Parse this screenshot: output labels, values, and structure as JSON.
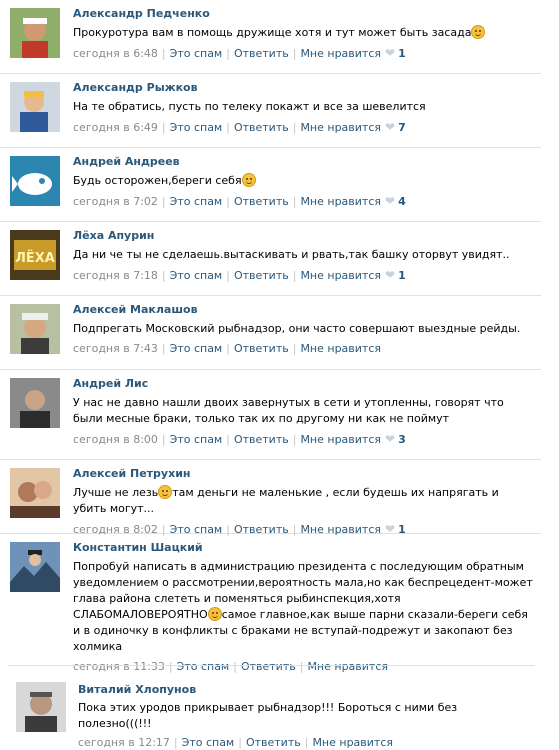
{
  "comments": [
    {
      "author": "Александр Педченко",
      "text": "Прокуротура вам в помощь дружище хотя и тут может быть засада",
      "emoji": true,
      "time": "сегодня в 6:48",
      "spam": "Это спам",
      "reply": "Ответить",
      "like": "Мне нравится",
      "likes": "1",
      "avatar_color": "#b06a3c"
    },
    {
      "author": "Александр Рыжков",
      "text": "На те обратись, пусть по телеку покажт и все за шевелится",
      "emoji": false,
      "time": "сегодня в 6:49",
      "spam": "Это спам",
      "reply": "Ответить",
      "like": "Мне нравится",
      "likes": "7",
      "avatar_color": "#7a8fa8"
    },
    {
      "author": "Андрей Андреев",
      "text": "Будь осторожен,береги себя",
      "emoji": true,
      "time": "сегодня в 7:02",
      "spam": "Это спам",
      "reply": "Ответить",
      "like": "Мне нравится",
      "likes": "4",
      "avatar_color": "#3a87a8"
    },
    {
      "author": "Лёха Апурин",
      "text": "Да ни че ты не сделаешь.вытаскивать и рвать,так башку оторвут увидят..",
      "emoji": false,
      "time": "сегодня в 7:18",
      "spam": "Это спам",
      "reply": "Ответить",
      "like": "Мне нравится",
      "likes": "1",
      "avatar_color": "#c79a2a"
    },
    {
      "author": "Алексей Маклашов",
      "text": "Подпрегать Московский рыбнадзор, они часто совершают выездные рейды.",
      "emoji": false,
      "time": "сегодня в 7:43",
      "spam": "Это спам",
      "reply": "Ответить",
      "like": "Мне нравится",
      "likes": "",
      "avatar_color": "#9aa07a"
    },
    {
      "author": "Андрей Лис",
      "text": "У нас не давно нашли двоих завернутых в сети и утопленны, говорят что были месные браки, только так их по другому ни как не поймут",
      "emoji": false,
      "time": "сегодня в 8:00",
      "spam": "Это спам",
      "reply": "Ответить",
      "like": "Мне нравится",
      "likes": "3",
      "avatar_color": "#6b6b6b"
    },
    {
      "author": "Алексей Петрухин",
      "text_before": "Лучше не лезь",
      "text": "там деньги не маленькие , если будешь их напрягать и убить могут...",
      "emoji_inline": true,
      "time": "сегодня в 8:02",
      "spam": "Это спам",
      "reply": "Ответить",
      "like": "Мне нравится",
      "likes": "1",
      "avatar_color": "#a06850"
    },
    {
      "author": "Константин Шацкий",
      "text_before": "Попробуй написать в администрацию президента с последующим обратным уведомлением о рассмотрении,вероятность мала,но как беспрецедент-может глава района слететь и поменяться рыбинспекция,хотя СЛАБОМАЛОВЕРОЯТНО",
      "text": "самое главное,как выше парни сказали-береги себя и в одиночку в конфликты с браками не вступай-подрежут и закопают без холмика",
      "emoji_inline": true,
      "time": "сегодня в 11:33",
      "spam": "Это спам",
      "reply": "Ответить",
      "like": "Мне нравится",
      "likes": "",
      "avatar_color": "#4a6a8a"
    },
    {
      "author": "Виталий Хлопунов",
      "text": "Пока этих уродов прикрывает рыбнадзор!!! Бороться с ними без полезно(((!!!",
      "emoji": false,
      "time": "сегодня в 12:17",
      "spam": "Это спам",
      "reply": "Ответить",
      "like": "Мне нравится",
      "likes": "",
      "avatar_color": "#5a5a5a"
    }
  ]
}
